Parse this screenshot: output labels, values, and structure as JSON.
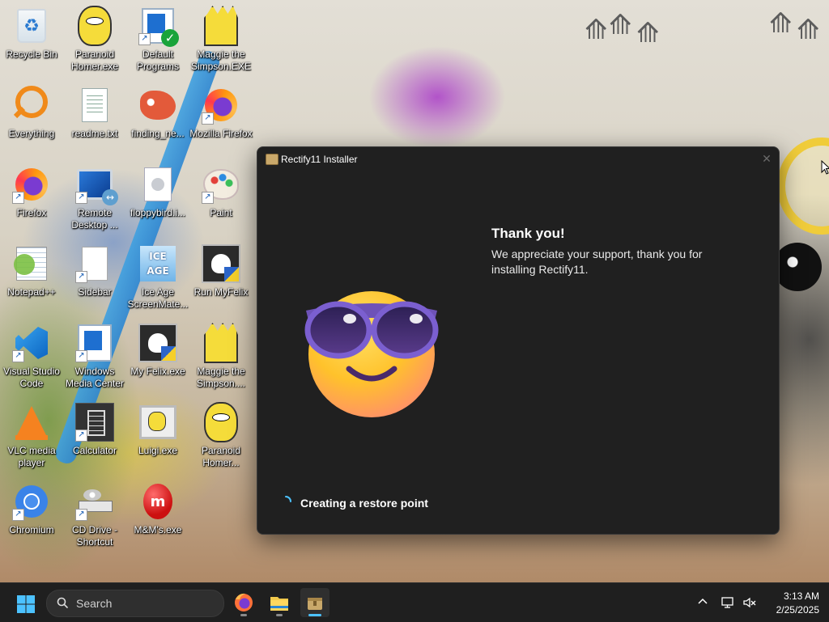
{
  "desktop": {
    "icons": [
      {
        "label": "Recycle Bin",
        "icon": "recycle-bin-icon"
      },
      {
        "label": "Paranoid Homer.exe",
        "icon": "homer-icon"
      },
      {
        "label": "Default Programs",
        "icon": "default-programs-icon"
      },
      {
        "label": "Maggie the Simpson.EXE",
        "icon": "maggie-icon"
      },
      {
        "label": "Everything",
        "icon": "everything-search-icon"
      },
      {
        "label": "readme.txt",
        "icon": "text-file-icon"
      },
      {
        "label": "finding_ne...",
        "icon": "fish-icon"
      },
      {
        "label": "Mozilla Firefox",
        "icon": "firefox-icon"
      },
      {
        "label": "Firefox",
        "icon": "firefox-icon"
      },
      {
        "label": "Remote Desktop ...",
        "icon": "remote-desktop-icon"
      },
      {
        "label": "floppybird.i...",
        "icon": "floppy-file-icon"
      },
      {
        "label": "Paint",
        "icon": "paint-icon"
      },
      {
        "label": "Notepad++",
        "icon": "notepad-plus-plus-icon"
      },
      {
        "label": "Sidebar",
        "icon": "blank-file-icon"
      },
      {
        "label": "Ice Age ScreenMate...",
        "icon": "ice-age-icon"
      },
      {
        "label": "Run MyFelix",
        "icon": "felix-icon"
      },
      {
        "label": "Visual Studio Code",
        "icon": "vscode-icon"
      },
      {
        "label": "Windows Media Center",
        "icon": "media-center-icon"
      },
      {
        "label": "My Felix.exe",
        "icon": "felix-icon"
      },
      {
        "label": "Maggie the Simpson....",
        "icon": "maggie-icon"
      },
      {
        "label": "VLC media player",
        "icon": "vlc-icon"
      },
      {
        "label": "Calculator",
        "icon": "calculator-icon"
      },
      {
        "label": "Luigi.exe",
        "icon": "luigi-icon"
      },
      {
        "label": "Paranoid Homer...",
        "icon": "homer-icon"
      },
      {
        "label": "Chromium",
        "icon": "chromium-icon"
      },
      {
        "label": "CD Drive - Shortcut",
        "icon": "cd-drive-icon"
      },
      {
        "label": "M&M's.exe",
        "icon": "mm-candy-icon"
      }
    ]
  },
  "installer": {
    "title": "Rectify11 Installer",
    "heading": "Thank you!",
    "body": "We appreciate your support, thank you for installing Rectify11.",
    "status": "Creating a restore point",
    "emoji_icon": "sunglasses-emoji-icon",
    "close_icon": "close-icon",
    "colors": {
      "background": "#202020",
      "spinner": "#4cc2ff"
    }
  },
  "taskbar": {
    "search_placeholder": "Search",
    "apps": [
      {
        "name": "Firefox",
        "icon": "firefox-icon"
      },
      {
        "name": "File Explorer",
        "icon": "folder-icon"
      },
      {
        "name": "Rectify11 Installer",
        "icon": "installer-icon"
      }
    ],
    "clock": {
      "time": "3:13 AM",
      "date": "2/25/2025"
    }
  }
}
